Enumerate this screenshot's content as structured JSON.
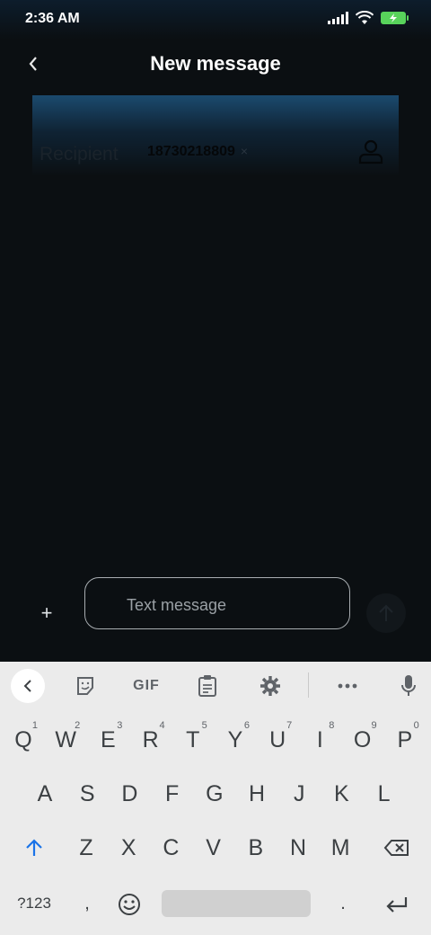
{
  "status_bar": {
    "time": "2:36 AM",
    "icons": [
      "signal-icon",
      "wifi-icon",
      "battery-charging-icon"
    ],
    "battery_color": "#58d35b"
  },
  "header": {
    "title": "New message",
    "back_icon": "chevron-left-icon"
  },
  "recipient": {
    "label": "Recipient",
    "chip": "18730218809",
    "chip_remove": "×",
    "contact_icon": "person-icon"
  },
  "compose": {
    "plus": "+",
    "placeholder": "Text message",
    "send_icon": "arrow-up-icon"
  },
  "keyboard": {
    "toolbar": {
      "gif_label": "GIF",
      "icons": [
        "chevron-left-icon",
        "sticker-icon",
        "gif-icon",
        "clipboard-icon",
        "gear-icon",
        "more-icon",
        "mic-icon"
      ]
    },
    "row1": [
      {
        "key": "Q",
        "hint": "1"
      },
      {
        "key": "W",
        "hint": "2"
      },
      {
        "key": "E",
        "hint": "3"
      },
      {
        "key": "R",
        "hint": "4"
      },
      {
        "key": "T",
        "hint": "5"
      },
      {
        "key": "Y",
        "hint": "6"
      },
      {
        "key": "U",
        "hint": "7"
      },
      {
        "key": "I",
        "hint": "8"
      },
      {
        "key": "O",
        "hint": "9"
      },
      {
        "key": "P",
        "hint": "0"
      }
    ],
    "row2": [
      "A",
      "S",
      "D",
      "F",
      "G",
      "H",
      "J",
      "K",
      "L"
    ],
    "row3": [
      "Z",
      "X",
      "C",
      "V",
      "B",
      "N",
      "M"
    ],
    "bottom": {
      "symbols": "?123",
      "comma": ",",
      "period": ".",
      "emoji_icon": "emoji-icon",
      "enter_icon": "enter-icon",
      "shift_icon": "shift-icon",
      "backspace_icon": "backspace-icon"
    },
    "accent_color": "#1a73e8"
  }
}
